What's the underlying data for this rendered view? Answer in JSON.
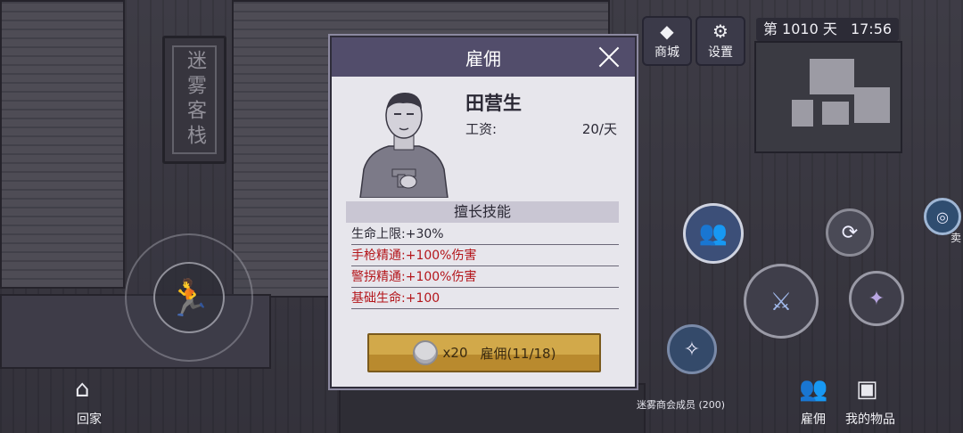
{
  "scene": {
    "sign_text": "迷雾客栈",
    "store_tag": "迷雾商会成员 (200)"
  },
  "hud": {
    "shop_label": "商城",
    "settings_label": "设置",
    "day_text": "第 1010 天",
    "time_text": "17:56"
  },
  "bottom": {
    "home_label": "回家",
    "hire_label": "雇佣",
    "items_label": "我的物品",
    "sell_label": "卖"
  },
  "modal": {
    "title": "雇佣",
    "name": "田营生",
    "wage_label": "工资:",
    "wage_value": "20/天",
    "skills_title": "擅长技能",
    "skills": [
      {
        "label": "生命上限:",
        "value": "+30%",
        "color": "#2b2935"
      },
      {
        "label": "手枪精通:",
        "value": "+100%伤害",
        "color": "#b4161b"
      },
      {
        "label": "警拐精通:",
        "value": "+100%伤害",
        "color": "#b4161b"
      },
      {
        "label": "基础生命:",
        "value": "+100",
        "color": "#b4161b"
      }
    ],
    "hire_cost": "x20",
    "hire_button": "雇佣(11/18)"
  },
  "colors": {
    "modal_header": "#524d6b",
    "hire_button": "#d2a94a",
    "skill_red": "#b4161b"
  }
}
